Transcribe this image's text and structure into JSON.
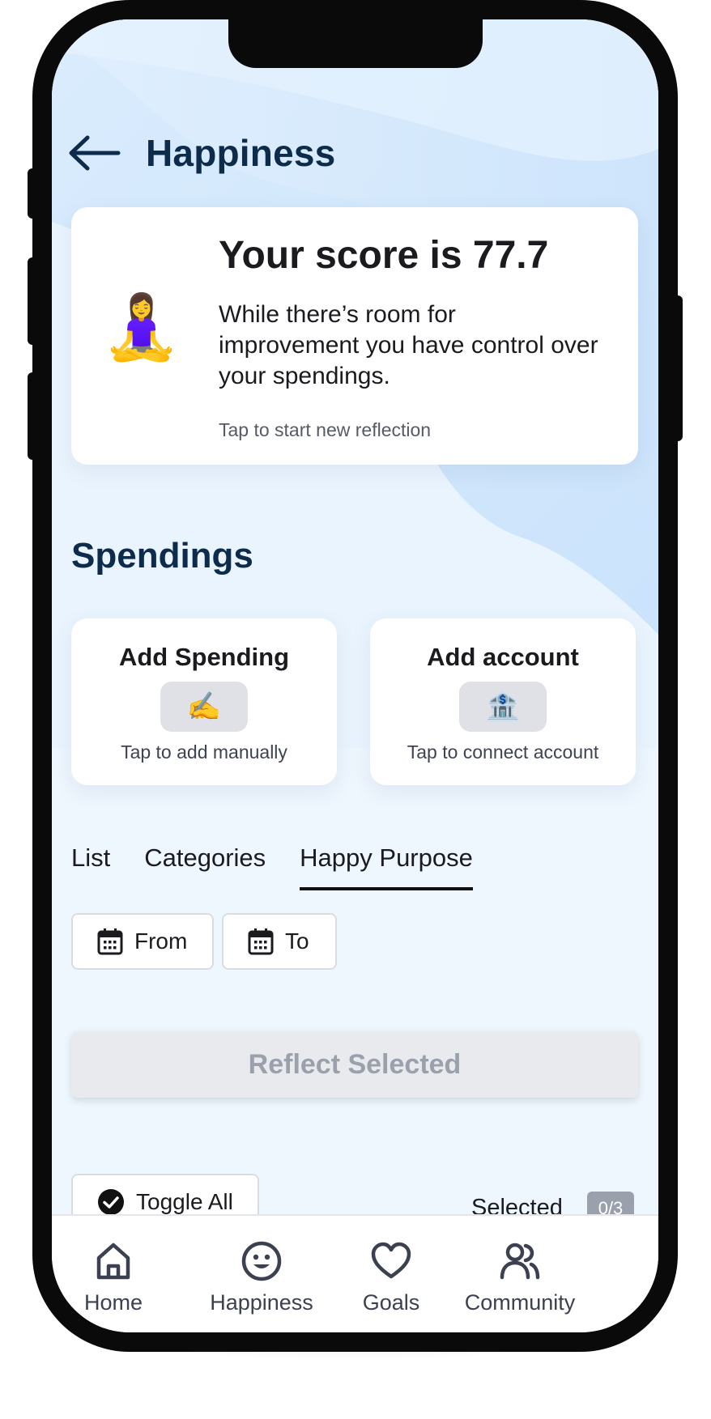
{
  "header": {
    "title": "Happiness",
    "back_icon": "arrow-left-icon"
  },
  "score_card": {
    "emoji": "🧘‍♀️",
    "title": "Your score is 77.7",
    "score": 77.7,
    "description": "While there’s room for improvement you have control over your spendings.",
    "hint": "Tap to start new reflection"
  },
  "spendings": {
    "section_title": "Spendings",
    "add_spending": {
      "title": "Add Spending",
      "plus": "+",
      "emoji": "✍️",
      "hint": "Tap to add manually"
    },
    "add_account": {
      "title": "Add account",
      "plus": "+",
      "emoji": "🏦",
      "hint": "Tap to connect account"
    }
  },
  "tabs": [
    {
      "label": "List",
      "active": false
    },
    {
      "label": "Categories",
      "active": false
    },
    {
      "label": "Happy Purpose",
      "active": true
    }
  ],
  "filters": {
    "from_label": "From",
    "to_label": "To",
    "icon": "calendar-icon"
  },
  "reflect_button": {
    "label": "Reflect Selected",
    "disabled": true
  },
  "selection": {
    "toggle_label": "Toggle All",
    "selected_label": "Selected",
    "selected_count": "0/3"
  },
  "bottom_nav": [
    {
      "label": "Home",
      "icon": "home-icon"
    },
    {
      "label": "Happiness",
      "icon": "smiley-icon"
    },
    {
      "label": "Goals",
      "icon": "heart-icon"
    },
    {
      "label": "Community",
      "icon": "people-icon"
    }
  ],
  "colors": {
    "title": "#0d2b4a",
    "background": "#eef6fe",
    "wave": "#cfe6fc",
    "disabled_text": "#9aa1ad"
  }
}
